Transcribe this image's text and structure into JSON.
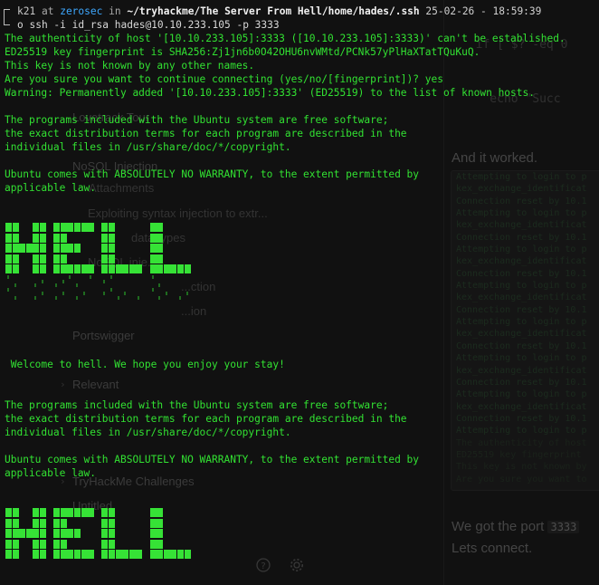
{
  "background": {
    "sidebar_items": [
      "Lovetrack Tour",
      "NoSQL Injection",
      "Attachments",
      "Exploiting syntax injection to extr...",
      "data types",
      "NoSQL inje...",
      "...ction",
      "...ion",
      "Portswigger",
      "Relevant",
      "TryHackMe Challenges",
      "Untitled"
    ],
    "code_top": [
      "  if [ $? -eq 0",
      "    echo \"Succ",
      "",
      "  fi",
      "done"
    ],
    "heading_worked": "And it worked.",
    "log_lines": [
      "Attempting to login to p",
      "kex_exchange_identificat",
      "Connection reset by 10.1",
      "Attempting to login to p",
      "kex_exchange_identificat",
      "Connection reset by 10.1",
      "Attempting to login to p",
      "kex_exchange_identificat",
      "Connection reset by 10.1",
      "Attempting to login to p",
      "kex_exchange_identificat",
      "Connection reset by 10.1",
      "Attempting to login to p",
      "kex_exchange_identificat",
      "Connection reset by 10.1",
      "Attempting to login to p",
      "kex_exchange_identificat",
      "Connection reset by 10.1",
      "Attempting to login to p",
      "kex_exchange_identificat",
      "Connection reset by 10.1",
      "Attempting to login to p",
      "The authenticity of host",
      "ED25519 key fingerprint",
      "This key is not known by",
      "Are you sure you want to"
    ],
    "port_text_prefix": "We got the port",
    "port_value": "3333",
    "connect_text": "Lets connect.",
    "icons": [
      "help-icon",
      "gear-icon"
    ]
  },
  "terminal": {
    "prompt": {
      "user": "k21",
      "at": "at",
      "host": "zerosec",
      "in": "in",
      "path": "~/tryhackme/The Server From Hell/home/hades/.ssh",
      "datetime": "25-02-26 - 18:59:39"
    },
    "command": "o ssh -i id_rsa hades@10.10.233.105 -p 3333",
    "output": [
      "The authenticity of host '[10.10.233.105]:3333 ([10.10.233.105]:3333)' can't be established.",
      "ED25519 key fingerprint is SHA256:Zj1jn6b0O42OHU6nvWMtd/PCNk57yPlHaXTatTQuKuQ.",
      "This key is not known by any other names.",
      "Are you sure you want to continue connecting (yes/no/[fingerprint])? yes",
      "Warning: Permanently added '[10.10.233.105]:3333' (ED25519) to the list of known hosts.",
      "",
      "The programs included with the Ubuntu system are free software;",
      "the exact distribution terms for each program are described in the",
      "individual files in /usr/share/doc/*/copyright.",
      "",
      "Ubuntu comes with ABSOLUTELY NO WARRANTY, to the extent permitted by",
      "applicable law."
    ],
    "welcome": " Welcome to hell. We hope you enjoy your stay!",
    "output2": [
      "The programs included with the Ubuntu system are free software;",
      "the exact distribution terms for each program are described in the",
      "individual files in /usr/share/doc/*/copyright.",
      "",
      "Ubuntu comes with ABSOLUTELY NO WARRANTY, to the extent permitted by",
      "applicable law."
    ],
    "colors": {
      "green": "#32e232",
      "blue": "#3ea8ff",
      "bg": "#141414"
    }
  }
}
